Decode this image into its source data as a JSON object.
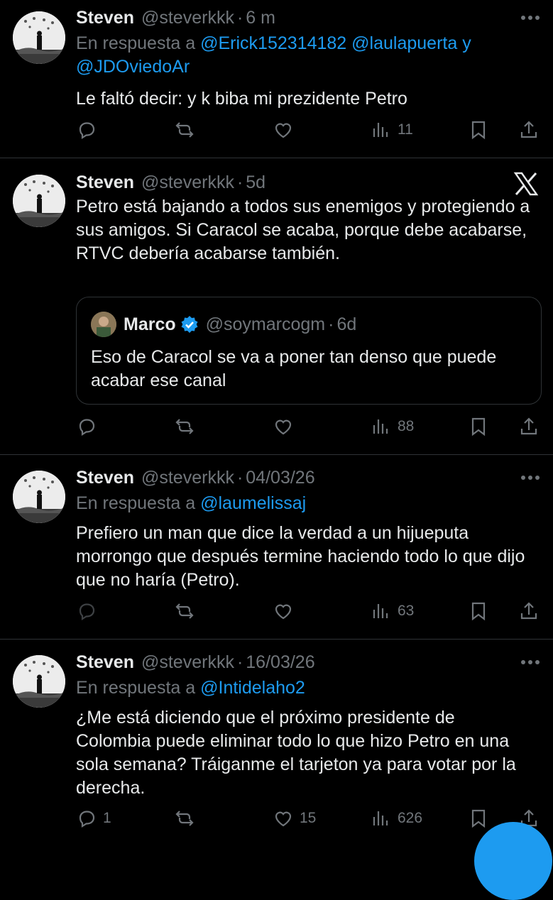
{
  "tweets": [
    {
      "name": "Steven",
      "handle": "@steverkkk",
      "sep": "·",
      "time": "6 m",
      "reply_prefix": "En respuesta a ",
      "mentions": [
        "@Erick152314182",
        "@laulapuerta",
        "@JDOviedoAr"
      ],
      "mention_join": " y",
      "text": "Le faltó decir: y k biba mi prezidente Petro",
      "stats": {
        "replies": "",
        "retweets": "",
        "likes": "",
        "views": "11"
      }
    },
    {
      "name": "Steven",
      "handle": "@steverkkk",
      "sep": "·",
      "time": "5d",
      "text": "Petro está bajando a todos sus enemigos y protegiendo a sus amigos. Si Caracol se acaba, porque debe acabarse, RTVC debería acabarse también.",
      "quote": {
        "name": "Marco",
        "handle": "@soymarcogm",
        "sep": "·",
        "time": "6d",
        "text": "Eso de Caracol se va a poner tan denso que puede acabar ese canal"
      },
      "stats": {
        "replies": "",
        "retweets": "",
        "likes": "",
        "views": "88"
      }
    },
    {
      "name": "Steven",
      "handle": "@steverkkk",
      "sep": "·",
      "time": "04/03/26",
      "reply_prefix": "En respuesta a ",
      "mentions": [
        "@laumelissaj"
      ],
      "text": "Prefiero un man que dice la verdad a un hijueputa morrongo que después termine haciendo todo lo que dijo que no haría (Petro).",
      "stats": {
        "replies": "",
        "retweets": "",
        "likes": "",
        "views": "63"
      }
    },
    {
      "name": "Steven",
      "handle": "@steverkkk",
      "sep": "·",
      "time": "16/03/26",
      "reply_prefix": "En respuesta a ",
      "mentions": [
        "@Intidelaho2"
      ],
      "text": "¿Me está diciendo que el próximo presidente de Colombia puede eliminar todo lo que hizo Petro en una sola semana? Tráiganme el tarjeton ya para votar por la derecha.",
      "stats": {
        "replies": "1",
        "retweets": "",
        "likes": "15",
        "views": "626"
      }
    }
  ],
  "icons": {
    "more": "more-icon",
    "reply": "reply-icon",
    "retweet": "retweet-icon",
    "like": "heart-icon",
    "views": "views-icon",
    "bookmark": "bookmark-icon",
    "share": "share-icon",
    "x": "x-logo-icon",
    "verified": "verified-badge-icon"
  },
  "colors": {
    "accent": "#1d9bf0",
    "muted": "#71767b",
    "text": "#e7e9ea",
    "background": "#000000"
  }
}
